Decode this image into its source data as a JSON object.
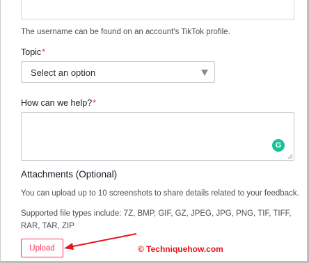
{
  "username_hint": "The username can be found on an account's TikTok profile.",
  "topic": {
    "label": "Topic",
    "required_mark": "*",
    "selected": "Select an option"
  },
  "help": {
    "label": "How can we help?",
    "required_mark": "*",
    "value": "",
    "grammarly_glyph": "G"
  },
  "attachments": {
    "title": "Attachments (Optional)",
    "limit_text": "You can upload up to 10 screenshots to share details related to your feedback.",
    "types_line1": "Supported file types include: 7Z, BMP, GIF, GZ, JPEG, JPG, PNG, TIF, TIFF,",
    "types_line2": "RAR, TAR, ZIP",
    "upload_label": "Upload"
  },
  "watermark": "© Techniquehow.com",
  "colors": {
    "accent": "#fe2c55",
    "annotation": "#e8141b",
    "grammarly": "#15c39a"
  }
}
